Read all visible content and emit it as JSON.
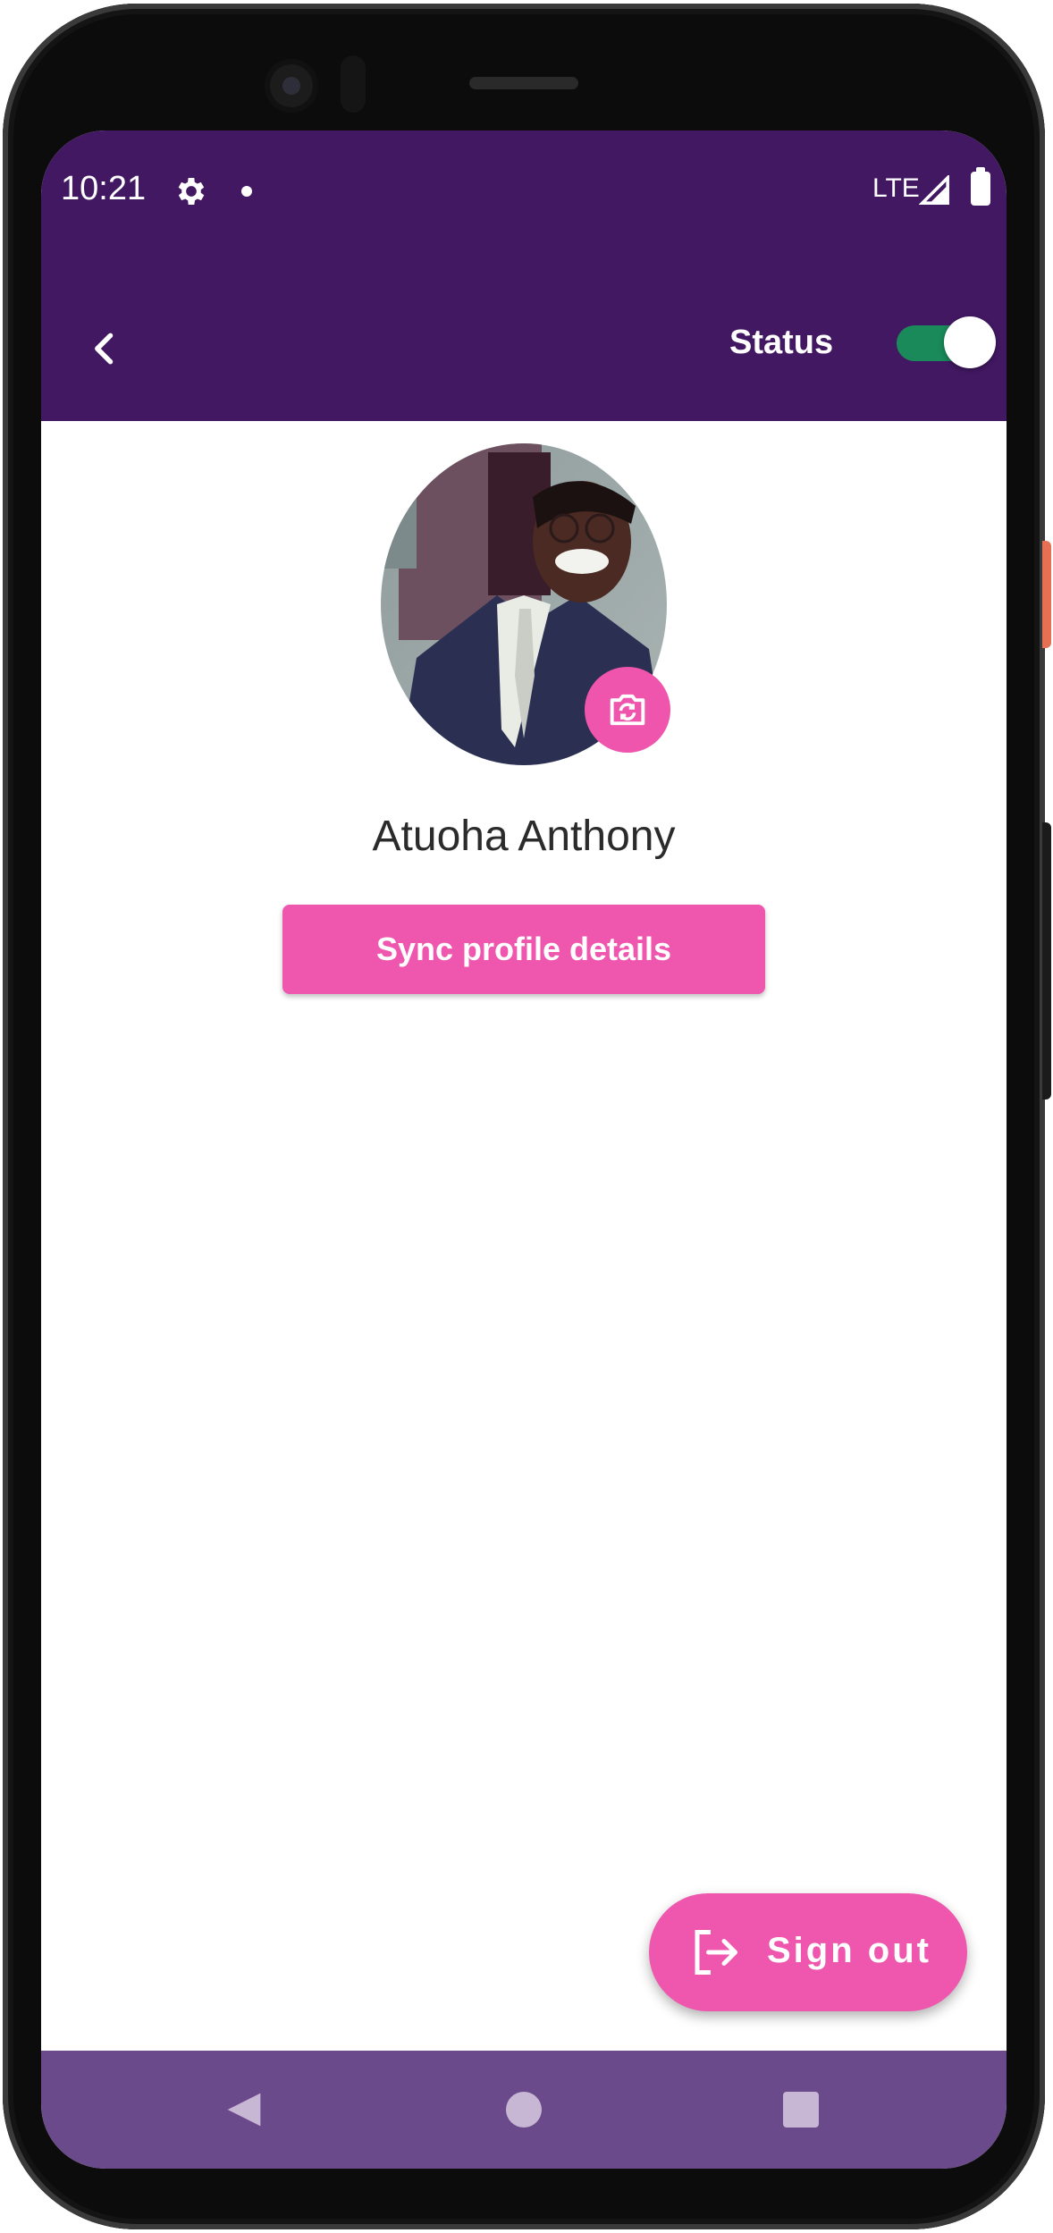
{
  "status_bar": {
    "time": "10:21",
    "network": "LTE",
    "icons": [
      "gear-icon",
      "notification-dot",
      "signal-icon",
      "battery-icon"
    ]
  },
  "app_bar": {
    "back_icon": "chevron-left-icon",
    "status_label": "Status",
    "status_toggle_on": true,
    "color": "#421862"
  },
  "profile": {
    "name": "Atuoha Anthony",
    "change_photo_icon": "camera-switch-icon",
    "sync_button_label": "Sync profile details"
  },
  "fab": {
    "label": "Sign out",
    "icon": "sign-out-icon",
    "color": "#ef56ae"
  },
  "nav_bar": {
    "items": [
      "nav-back-icon",
      "nav-home-icon",
      "nav-recents-icon"
    ]
  }
}
